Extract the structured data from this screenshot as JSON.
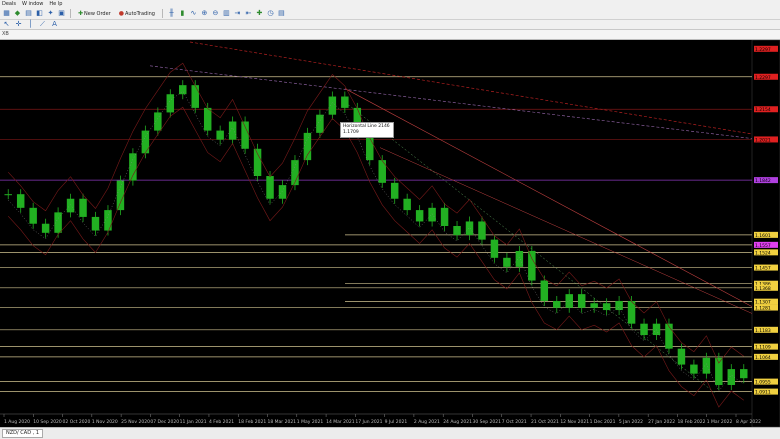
{
  "menu": {
    "items": [
      "Deals",
      "W indow",
      "He lp"
    ]
  },
  "toolbar": {
    "new_order_label": "New Order",
    "autotrading_label": "AutoTrading",
    "icons": [
      "chart-bar-icon",
      "chart-candle-icon",
      "chart-line-icon",
      "zoom-in-icon",
      "zoom-out-icon",
      "tile-icon",
      "scroll-icon",
      "shift-icon",
      "indicators-icon",
      "periods-icon",
      "templates-icon"
    ]
  },
  "subheader": {
    "symbol_label": "XB"
  },
  "tooltip": {
    "line1": "Horizontal Line 2146",
    "line2": "1.1709"
  },
  "bottom": {
    "tab_label": "NZD/ CAD , 1"
  },
  "colors": {
    "background": "#000000",
    "candle": "#22b022",
    "hline": "#e8d8a0",
    "red_line": "#8b1a1a",
    "purple_line": "#9a40d0",
    "trend": "#b02020"
  },
  "chart_data": {
    "type": "candlestick",
    "x_tick_labels": [
      "1 Aug 2020",
      "10 Sep 2020",
      "02 Oct 2020",
      "1 Nov 2020",
      "25 Nov 2020",
      "07 Dec 2020",
      "11 Jan 2021",
      "4 Feb 2021",
      "18 Feb 2021",
      "18 Mar 2021",
      "1 May 2021",
      "14 Mar 2021",
      "17 Jun 2021",
      "9 Jul 2021",
      "2 Aug 2021",
      "24 Aug 2021",
      "30 Sep 2021",
      "7 Oct 2021",
      "21 Oct 2021",
      "12 Nov 2021",
      "1 Dec 2021",
      "5 Jan 2022",
      "27 Jan 2022",
      "18 Feb 2022",
      "1 Mar 2022",
      "8 Apr 2022"
    ],
    "price_series_normalized_note": "",
    "closes": [
      1.178,
      1.172,
      1.165,
      1.161,
      1.17,
      1.176,
      1.168,
      1.162,
      1.171,
      1.184,
      1.196,
      1.206,
      1.214,
      1.222,
      1.226,
      1.216,
      1.206,
      1.202,
      1.21,
      1.198,
      1.186,
      1.176,
      1.182,
      1.193,
      1.205,
      1.213,
      1.221,
      1.216,
      1.206,
      1.193,
      1.183,
      1.176,
      1.171,
      1.166,
      1.172,
      1.164,
      1.16,
      1.166,
      1.158,
      1.15,
      1.146,
      1.153,
      1.14,
      1.131,
      1.128,
      1.134,
      1.128,
      1.13,
      1.127,
      1.131,
      1.121,
      1.116,
      1.121,
      1.11,
      1.103,
      1.099,
      1.106,
      1.094,
      1.101,
      1.097
    ],
    "horizontal_levels": [
      1.2297,
      1.2154,
      1.2021,
      1.1842,
      1.1601,
      1.1557,
      1.1524,
      1.1457,
      1.1386,
      1.1368,
      1.1307,
      1.1281,
      1.1183,
      1.1109,
      1.1064,
      1.0955,
      1.0911
    ],
    "price_labels": [
      "1.2297",
      "1.2297",
      "1.2154",
      "1.2021",
      "1.1842",
      "1.1601",
      "1.1557",
      "1.1524",
      "1.1457",
      "1.1386",
      "1.1368",
      "1.1307",
      "1.1281",
      "1.1183",
      "1.1109",
      "1.1064",
      "1.0955",
      "1.0911"
    ],
    "ylim": [
      1.083,
      1.245
    ],
    "grid": false,
    "legend": "none"
  }
}
